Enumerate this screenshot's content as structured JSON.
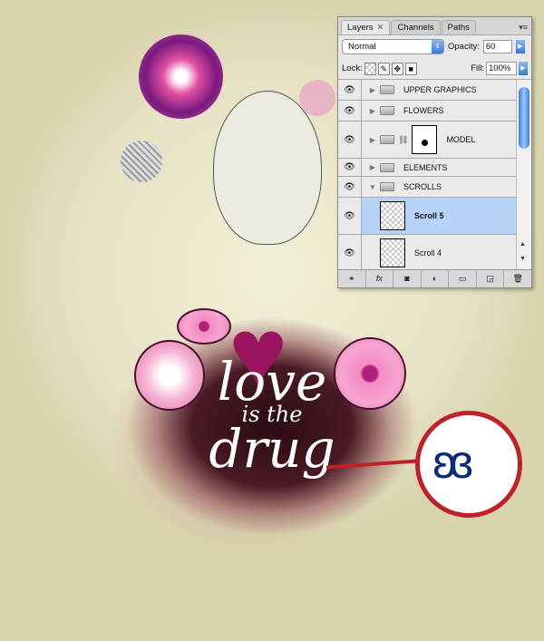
{
  "artwork": {
    "line1": "love",
    "line2": "is the",
    "line3": "drug"
  },
  "colors": {
    "accent": "#9b1460",
    "zoom_ring": "#c0202a",
    "selected_layer": "#b6d4f8"
  },
  "panel": {
    "tabs": [
      {
        "label": "Layers",
        "active": true
      },
      {
        "label": "Channels"
      },
      {
        "label": "Paths"
      }
    ],
    "blend_mode": "Normal",
    "opacity_label": "Opacity:",
    "opacity": "60",
    "lock_label": "Lock:",
    "fill_label": "Fill:",
    "fill": "100%",
    "layers": [
      {
        "name": "UPPER GRAPHICS",
        "type": "group"
      },
      {
        "name": "FLOWERS",
        "type": "group"
      },
      {
        "name": "MODEL",
        "type": "group-mask"
      },
      {
        "name": "ELEMENTS",
        "type": "group"
      },
      {
        "name": "SCROLLS",
        "type": "group-open"
      },
      {
        "name": "Scroll 5",
        "type": "layer",
        "selected": true
      },
      {
        "name": "Scroll 4",
        "type": "layer"
      }
    ],
    "bottom_icons": [
      "link-icon",
      "fx-icon",
      "mask-icon",
      "adjustment-icon",
      "new-group-icon",
      "new-layer-icon",
      "trash-icon"
    ]
  }
}
